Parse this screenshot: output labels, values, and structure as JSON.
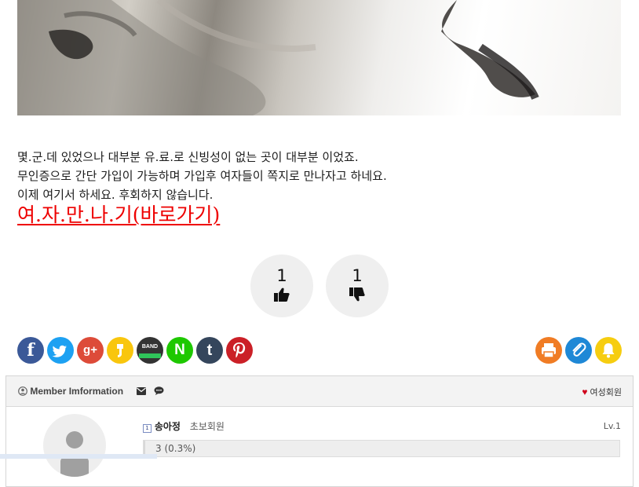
{
  "post": {
    "paragraphs": [
      "몇.군.데 있었으나 대부분 유.료.로 신빙성이 없는 곳이 대부분 이었죠.",
      "무인증으로 간단 가입이 가능하며 가입후 여자들이 쪽지로 만나자고 하네요.",
      "이제 여기서 하세요. 후회하지 않습니다."
    ],
    "cta_link": "여.자.만.나.기(바로가기)"
  },
  "votes": {
    "up_count": "1",
    "down_count": "1"
  },
  "share": {
    "facebook": "f",
    "twitter": "twitter-icon",
    "googleplus": "g+",
    "kakaostory": "kakaostory-icon",
    "band": "BAND",
    "naver": "N",
    "tumblr": "t",
    "pinterest": "pinterest-icon",
    "colors": {
      "facebook": "#3b5998",
      "twitter": "#1da1f2",
      "googleplus": "#dd4b39",
      "kakaostory": "#f9c60d",
      "band": "#333333",
      "naver": "#1ec800",
      "tumblr": "#35465c",
      "pinterest": "#cb2027",
      "print": "#f07c24",
      "attach": "#1e88d6",
      "alarm": "#f6cd10"
    }
  },
  "member": {
    "title": "Member Imformation",
    "gender_label": "여성회원",
    "level_badge": "1",
    "username": "송아정",
    "grade": "초보회원",
    "level": "Lv.1",
    "progress_text": "3 (0.3%)",
    "progress": 0.003
  }
}
